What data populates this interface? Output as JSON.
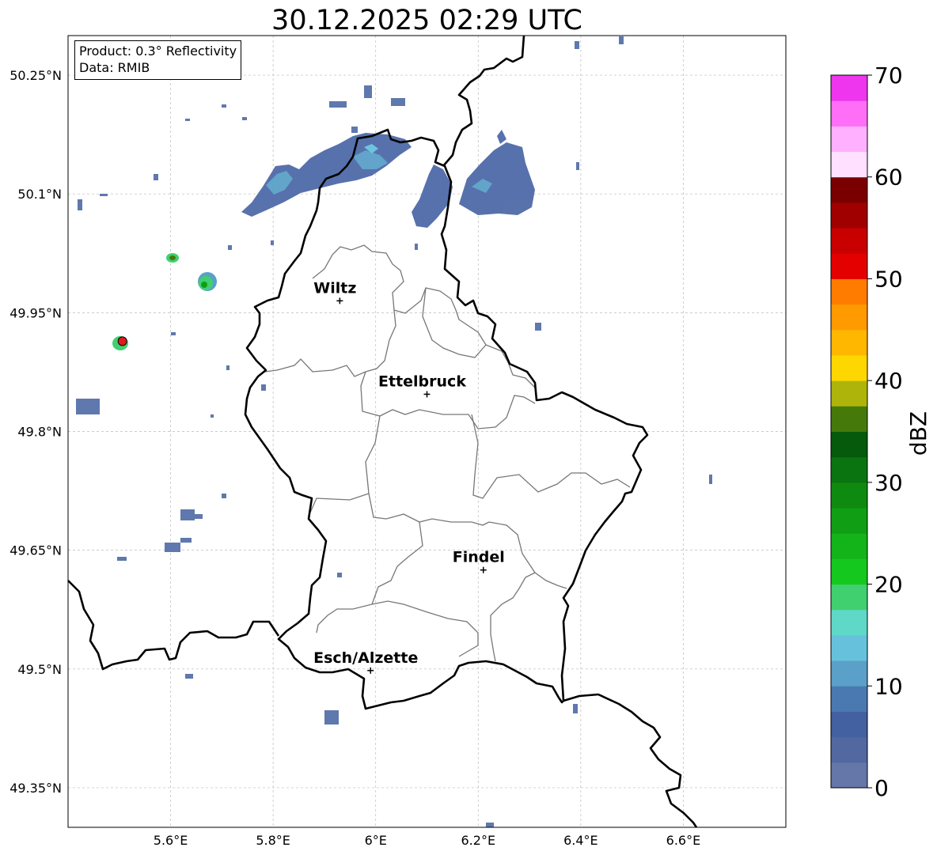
{
  "title": "30.12.2025 02:29 UTC",
  "info": {
    "product": "Product: 0.3° Reflectivity",
    "data_source": "Data: RMIB"
  },
  "map": {
    "lon_range": [
      5.4,
      6.8
    ],
    "lat_range": [
      49.3,
      50.3
    ],
    "lon_ticks": [
      {
        "value": 5.6,
        "label": "5.6°E"
      },
      {
        "value": 5.8,
        "label": "5.8°E"
      },
      {
        "value": 6.0,
        "label": "6°E"
      },
      {
        "value": 6.2,
        "label": "6.2°E"
      },
      {
        "value": 6.4,
        "label": "6.4°E"
      },
      {
        "value": 6.6,
        "label": "6.6°E"
      }
    ],
    "lat_ticks": [
      {
        "value": 50.25,
        "label": "50.25°N"
      },
      {
        "value": 50.1,
        "label": "50.1°N"
      },
      {
        "value": 49.95,
        "label": "49.95°N"
      },
      {
        "value": 49.8,
        "label": "49.8°N"
      },
      {
        "value": 49.65,
        "label": "49.65°N"
      },
      {
        "value": 49.5,
        "label": "49.5°N"
      },
      {
        "value": 49.35,
        "label": "49.35°N"
      }
    ],
    "grid": true,
    "cities": [
      {
        "name": "Wiltz",
        "lon": 5.93,
        "lat": 49.965
      },
      {
        "name": "Ettelbruck",
        "lon": 6.1,
        "lat": 49.847
      },
      {
        "name": "Findel",
        "lon": 6.21,
        "lat": 49.625
      },
      {
        "name": "Esch/Alzette",
        "lon": 5.99,
        "lat": 49.498
      }
    ],
    "radar_site": {
      "lon": 5.506,
      "lat": 49.914,
      "color": "#e31a1c"
    }
  },
  "colorbar": {
    "label": "dBZ",
    "min": 0,
    "max": 70,
    "step": 2.5,
    "ticks": [
      0,
      10,
      20,
      30,
      40,
      50,
      60,
      70
    ],
    "colors": [
      "#6577a8",
      "#5268a0",
      "#4360a0",
      "#4a78b0",
      "#5aa0c8",
      "#66c2dc",
      "#60d8c8",
      "#40d070",
      "#14c81e",
      "#12b41a",
      "#109e14",
      "#0e8a10",
      "#0a7410",
      "#065a0c",
      "#457a0a",
      "#aeb40a",
      "#ffd700",
      "#ffb700",
      "#ff9a00",
      "#ff7c00",
      "#e50000",
      "#c80000",
      "#a00000",
      "#7a0000",
      "#ffe0ff",
      "#ffb0ff",
      "#ff6ef7",
      "#ee36ee"
    ]
  }
}
